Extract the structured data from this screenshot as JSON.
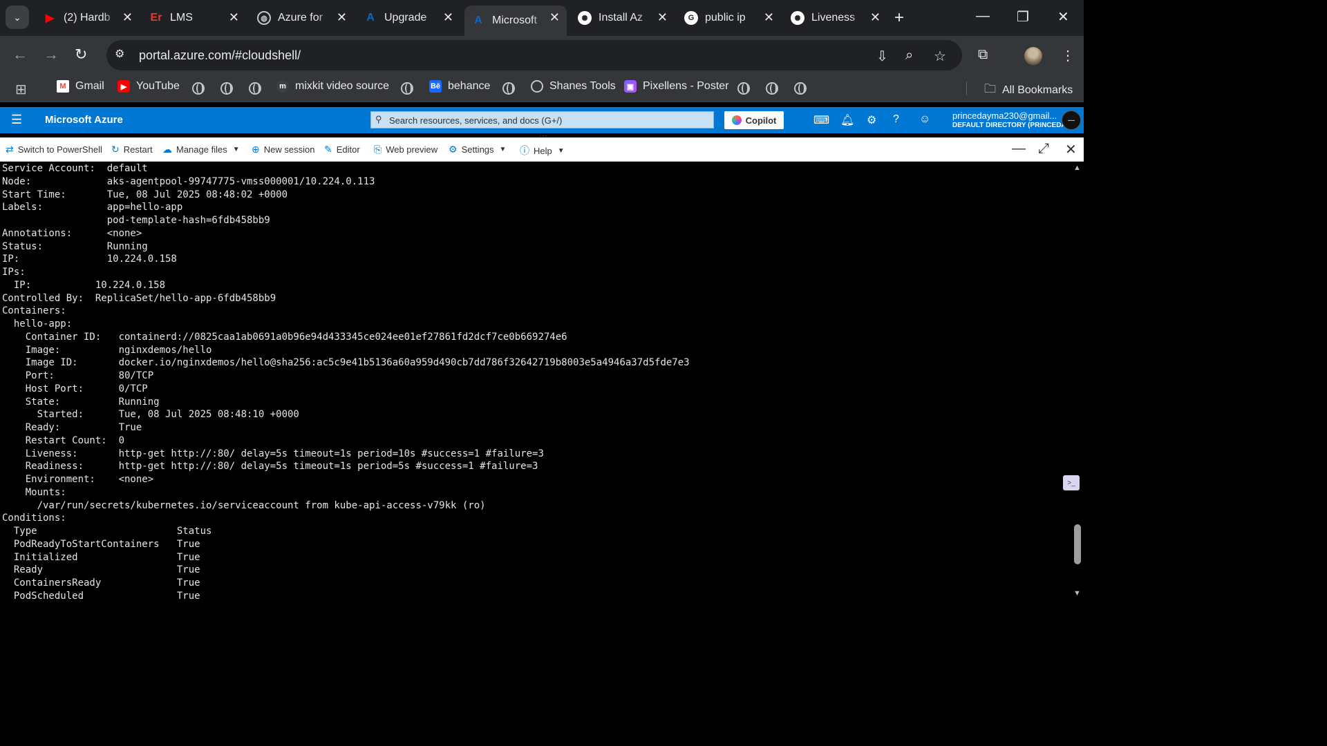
{
  "browser": {
    "tabs": [
      {
        "title": "(2) Hardb",
        "favicon": "youtube-icon",
        "color": "#ff0000",
        "glyph": "▶"
      },
      {
        "title": "LMS",
        "favicon": "lms-icon",
        "color": "#e53935",
        "glyph": "Er"
      },
      {
        "title": "Azure for",
        "favicon": "globe-icon",
        "color": "#5f6368",
        "glyph": "◍"
      },
      {
        "title": "Upgrade",
        "favicon": "azure-icon",
        "color": "#0a66c2",
        "glyph": "A"
      },
      {
        "title": "Microsoft",
        "favicon": "azure-icon",
        "color": "#0a66c2",
        "glyph": "A",
        "active": true
      },
      {
        "title": "Install Az",
        "favicon": "chatgpt-icon",
        "color": "#ffffff",
        "glyph": "✺"
      },
      {
        "title": "public ip",
        "favicon": "google-icon",
        "color": "#ffffff",
        "glyph": "G"
      },
      {
        "title": "Liveness",
        "favicon": "chatgpt-icon",
        "color": "#ffffff",
        "glyph": "✺"
      }
    ],
    "url": "portal.azure.com/#cloudshell/",
    "bookmarks": {
      "gmail": "Gmail",
      "youtube": "YouTube",
      "mixkit": "mixkit video source",
      "behance": "behance",
      "shanes": "Shanes Tools",
      "pixellens": "Pixellens - Poster",
      "all": "All Bookmarks"
    }
  },
  "azure": {
    "brand": "Microsoft Azure",
    "search_placeholder": "Search resources, services, and docs (G+/)",
    "copilot": "Copilot",
    "account_email": "princedayma230@gmail...",
    "account_dir": "DEFAULT DIRECTORY (PRINCEDA..."
  },
  "cloudshell_toolbar": {
    "switch": "Switch to PowerShell",
    "restart": "Restart",
    "manage_files": "Manage files",
    "new_session": "New session",
    "editor": "Editor",
    "web_preview": "Web preview",
    "settings": "Settings",
    "help": "Help"
  },
  "terminal": {
    "lines": [
      "Service Account:  default",
      "Node:             aks-agentpool-99747775-vmss000001/10.224.0.113",
      "Start Time:       Tue, 08 Jul 2025 08:48:02 +0000",
      "Labels:           app=hello-app",
      "                  pod-template-hash=6fdb458bb9",
      "Annotations:      <none>",
      "Status:           Running",
      "IP:               10.224.0.158",
      "IPs:",
      "  IP:           10.224.0.158",
      "Controlled By:  ReplicaSet/hello-app-6fdb458bb9",
      "Containers:",
      "  hello-app:",
      "    Container ID:   containerd://0825caa1ab0691a0b96e94d433345ce024ee01ef27861fd2dcf7ce0b669274e6",
      "    Image:          nginxdemos/hello",
      "    Image ID:       docker.io/nginxdemos/hello@sha256:ac5c9e41b5136a60a959d490cb7dd786f32642719b8003e5a4946a37d5fde7e3",
      "    Port:           80/TCP",
      "    Host Port:      0/TCP",
      "    State:          Running",
      "      Started:      Tue, 08 Jul 2025 08:48:10 +0000",
      "    Ready:          True",
      "    Restart Count:  0",
      "    Liveness:       http-get http://:80/ delay=5s timeout=1s period=10s #success=1 #failure=3",
      "    Readiness:      http-get http://:80/ delay=5s timeout=1s period=5s #success=1 #failure=3",
      "    Environment:    <none>",
      "    Mounts:",
      "      /var/run/secrets/kubernetes.io/serviceaccount from kube-api-access-v79kk (ro)",
      "Conditions:",
      "  Type                        Status",
      "  PodReadyToStartContainers   True",
      "  Initialized                 True",
      "  Ready                       True",
      "  ContainersReady             True",
      "  PodScheduled                True"
    ]
  },
  "colors": {
    "azure_blue": "#0078d4",
    "chrome_dark": "#202124",
    "chrome_toolbar": "#35363a"
  }
}
